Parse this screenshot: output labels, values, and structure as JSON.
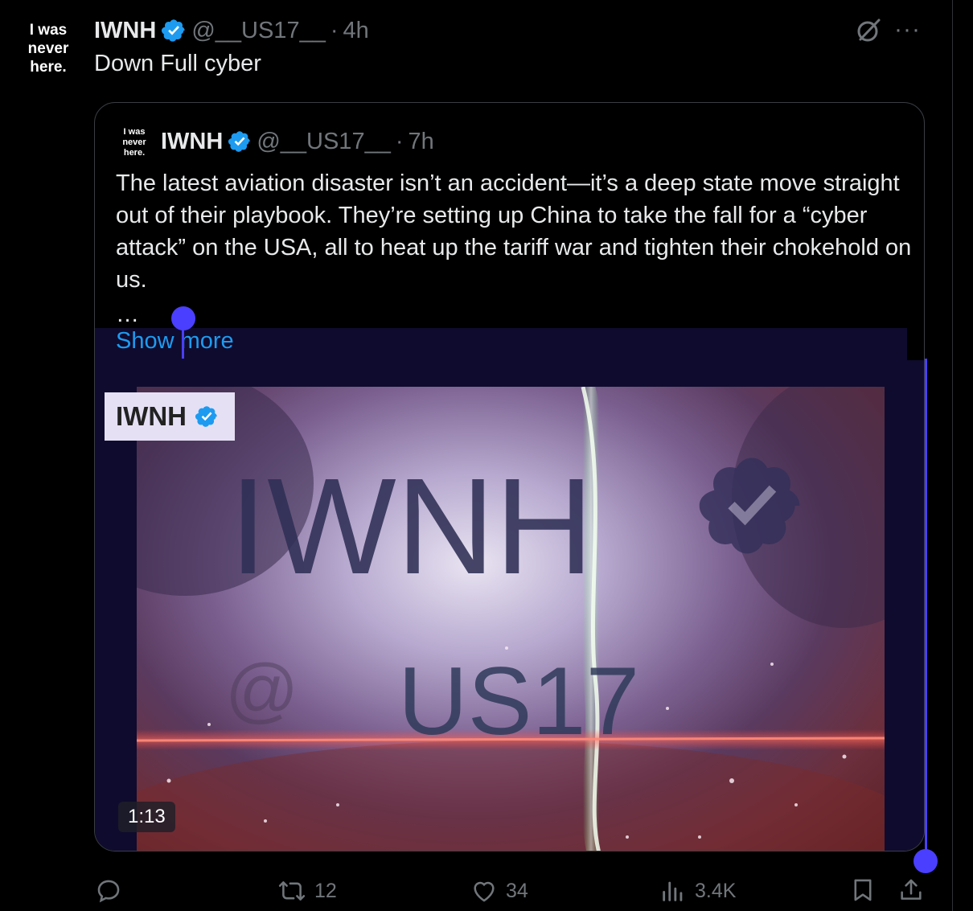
{
  "tweet": {
    "avatar_lines": [
      "I was",
      "never",
      "here."
    ],
    "name": "IWNH",
    "handle": "@__US17__",
    "separator": "·",
    "time": "4h",
    "text": "Down Full cyber"
  },
  "quoted": {
    "avatar_lines": [
      "I was",
      "never",
      "here."
    ],
    "name": "IWNH",
    "handle": "@__US17__",
    "separator": "·",
    "time": "7h",
    "body": "The latest aviation disaster isn’t an accident—it’s a deep state move straight out of their playbook. They’re setting up China to take the fall for a “cyber attack” on the USA, all to heat up the tariff war and tighten their chokehold on us.",
    "ellipsis": "…",
    "show_more": "Show more",
    "media": {
      "label_name": "IWNH",
      "video_title": "IWNH",
      "video_at": "@",
      "video_handle": "US17",
      "duration": "1:13"
    }
  },
  "actions": {
    "reply_count": "",
    "repost_count": "12",
    "like_count": "34",
    "views_count": "3.4K"
  },
  "icons": {
    "verified": "verified-badge-icon",
    "grok": "grok-icon",
    "more": "more-icon",
    "reply": "reply-icon",
    "repost": "repost-icon",
    "like": "heart-icon",
    "views": "views-icon",
    "bookmark": "bookmark-icon",
    "share": "share-icon"
  },
  "colors": {
    "background": "#000000",
    "text": "#e7e9ea",
    "muted": "#71767b",
    "link": "#1d9bf0",
    "verified": "#1d9bf0",
    "selection": "#4a3fff"
  }
}
